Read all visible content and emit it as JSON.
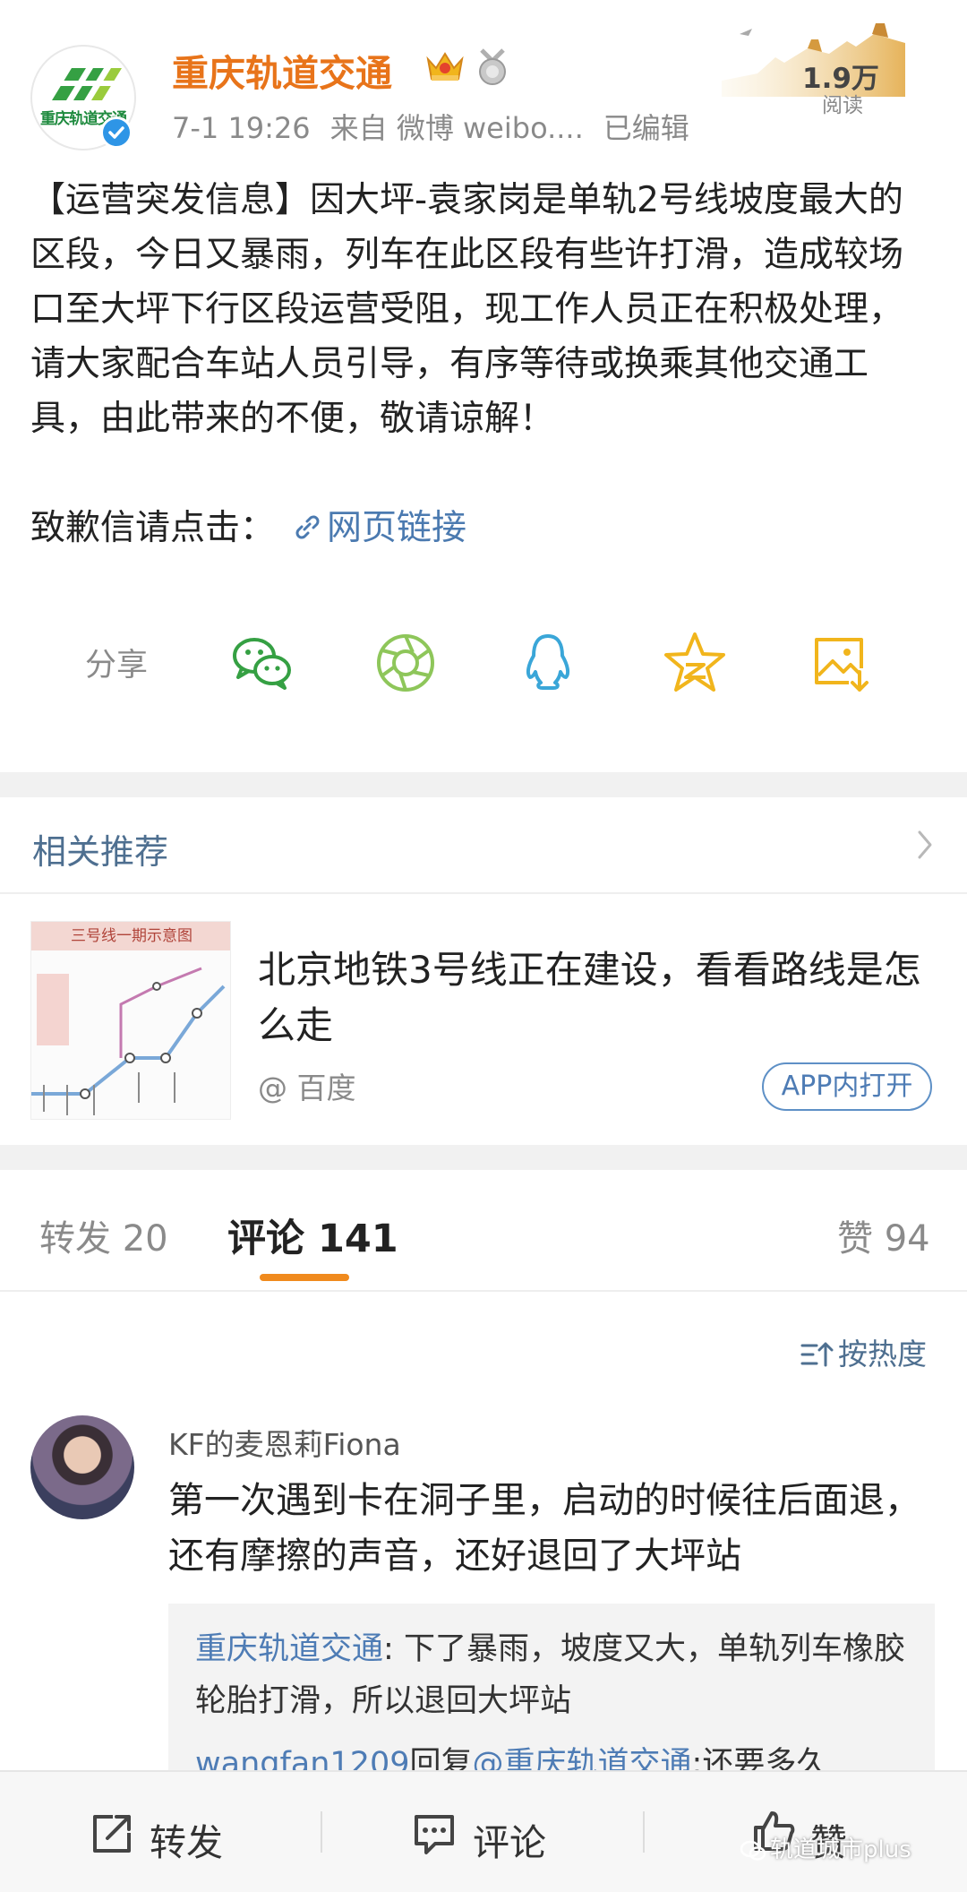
{
  "post": {
    "account_name": "重庆轨道交通",
    "logo_text": "重庆轨道交通",
    "meta": {
      "time": "7-1 19:26",
      "source": "来自 微博 weibo....",
      "edited": "已编辑"
    },
    "reads": {
      "count": "1.9万",
      "label": "阅读"
    },
    "body": "【运营突发信息】因大坪-袁家岗是单轨2号线坡度最大的区段，今日又暴雨，列车在此区段有些许打滑，造成较场口至大坪下行区段运营受阻，现工作人员正在积极处理，请大家配合车站人员引导，有序等待或换乘其他交通工具，由此带来的不便，敬请谅解！",
    "apology_prefix": "致歉信请点击：",
    "apology_link": "网页链接"
  },
  "share": {
    "label": "分享",
    "icons": [
      "wechat-icon",
      "moments-icon",
      "qq-icon",
      "qzone-icon",
      "save-image-icon"
    ]
  },
  "related": {
    "title": "相关推荐",
    "item": {
      "thumb_caption": "三号线一期示意图",
      "title": "北京地铁3号线正在建设，看看路线是怎么走",
      "source": "@ 百度",
      "open_button": "APP内打开"
    }
  },
  "tabs": {
    "repost": "转发 20",
    "comments": "评论 141",
    "likes": "赞 94"
  },
  "sort_label": "按热度",
  "comment": {
    "author": "KF的麦恩莉Fiona",
    "text": "第一次遇到卡在洞子里，启动的时候往后面退，还有摩擦的声音，还好退回了大坪站",
    "replies": [
      {
        "author": "重庆轨道交通",
        "sep": ":",
        "text": " 下了暴雨，坡度又大，单轨列车橡胶轮胎打滑，所以退回大坪站"
      },
      {
        "author": "wangfan1209",
        "mid": "回复",
        "target": "@重庆轨道交通",
        "text": ":还要多久"
      }
    ]
  },
  "bottom_bar": {
    "repost": "转发",
    "comment": "评论",
    "like": "赞"
  },
  "watermark": "轨道城市plus",
  "colors": {
    "brand_orange": "#e8741a",
    "link_blue": "#4e7cb5",
    "tab_indicator": "#f08a1d",
    "logo_green": "#1e8a3e"
  }
}
